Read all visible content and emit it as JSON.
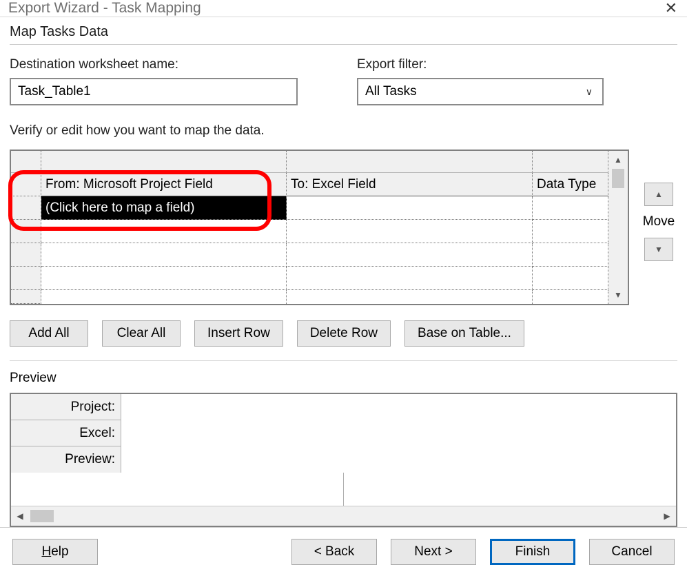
{
  "window": {
    "title": "Export Wizard - Task Mapping"
  },
  "section": {
    "title": "Map Tasks Data"
  },
  "fields": {
    "worksheet": {
      "label": "Destination worksheet name:",
      "value": "Task_Table1"
    },
    "filter": {
      "label": "Export filter:",
      "value": "All Tasks"
    }
  },
  "mapping": {
    "description": "Verify or edit how you want to map the data.",
    "headers": {
      "from": "From: Microsoft Project Field",
      "to": "To:  Excel Field",
      "type": "Data Type"
    },
    "placeholder": "(Click here to map a field)"
  },
  "move": {
    "label": "Move"
  },
  "gridButtons": {
    "addAll": "Add All",
    "clearAll": "Clear All",
    "insertRow": "Insert Row",
    "deleteRow": "Delete Row",
    "baseOnTable": "Base on Table..."
  },
  "preview": {
    "title": "Preview",
    "rows": {
      "project": "Project:",
      "excel": "Excel:",
      "preview": "Preview:"
    }
  },
  "footer": {
    "help": "Help",
    "back": "< Back",
    "next": "Next >",
    "finish": "Finish",
    "cancel": "Cancel"
  }
}
